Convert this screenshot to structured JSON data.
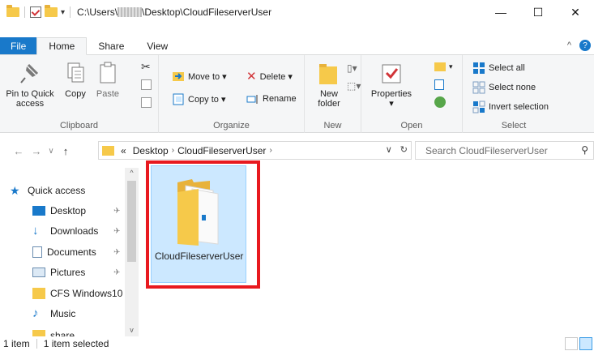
{
  "window": {
    "title_prefix": "C:\\Users\\",
    "title_suffix": "\\Desktop\\CloudFileserverUser",
    "minimize": "—",
    "maximize": "☐",
    "close": "✕"
  },
  "tabs": [
    {
      "label": "File"
    },
    {
      "label": "Home"
    },
    {
      "label": "Share"
    },
    {
      "label": "View"
    }
  ],
  "ribbon": {
    "clipboard": {
      "label": "Clipboard",
      "pin": "Pin to Quick\naccess",
      "copy": "Copy",
      "paste": "Paste"
    },
    "organize": {
      "label": "Organize",
      "move_to": "Move to ▾",
      "copy_to": "Copy to ▾",
      "delete": "Delete ▾",
      "rename": "Rename"
    },
    "new": {
      "label": "New",
      "new_folder": "New\nfolder"
    },
    "open": {
      "label": "Open",
      "properties": "Properties\n▾"
    },
    "select": {
      "label": "Select",
      "select_all": "Select all",
      "select_none": "Select none",
      "invert": "Invert selection"
    }
  },
  "address": {
    "prefix": "«",
    "crumb1": "Desktop",
    "crumb2": "CloudFileserverUser",
    "search_placeholder": "Search CloudFileserverUser"
  },
  "nav": {
    "items": [
      {
        "label": "Quick access"
      },
      {
        "label": "Desktop"
      },
      {
        "label": "Downloads"
      },
      {
        "label": "Documents"
      },
      {
        "label": "Pictures"
      },
      {
        "label": "CFS Windows10"
      },
      {
        "label": "Music"
      },
      {
        "label": "share"
      }
    ]
  },
  "content": {
    "folder_name": "CloudFileserverUser"
  },
  "status": {
    "count": "1 item",
    "selected": "1 item selected"
  },
  "colors": {
    "accent": "#1979ca",
    "selection_bg": "#cce8ff",
    "highlight_frame": "#e8191f",
    "folder": "#f6c94a"
  }
}
